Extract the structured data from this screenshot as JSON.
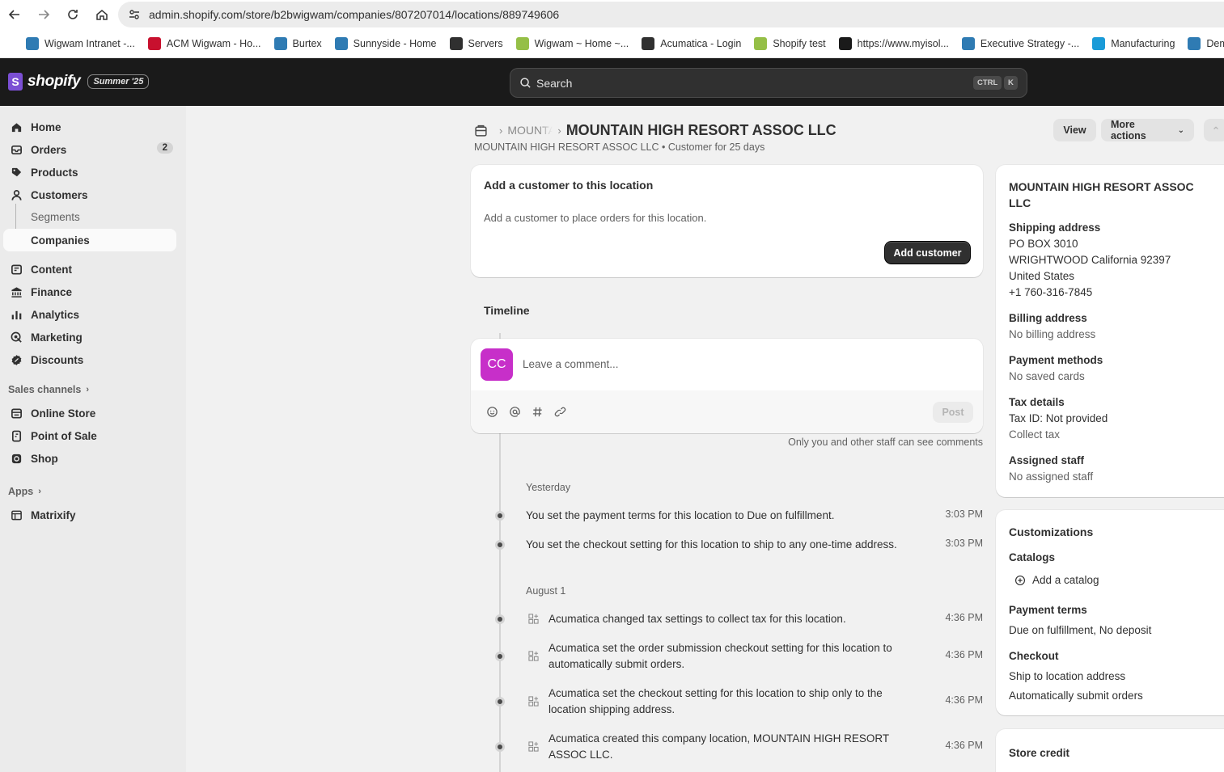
{
  "browser": {
    "url": "admin.shopify.com/store/b2bwigwam/companies/807207014/locations/889749606",
    "bookmarks": [
      {
        "label": "Wigwam Intranet -...",
        "color": "#2f7bb3"
      },
      {
        "label": "ACM Wigwam - Ho...",
        "color": "#c8102e"
      },
      {
        "label": "Burtex",
        "color": "#2f7bb3"
      },
      {
        "label": "Sunnyside - Home",
        "color": "#2f7bb3"
      },
      {
        "label": "Servers",
        "color": "#303030"
      },
      {
        "label": "Wigwam ~ Home ~...",
        "color": "#95bf47"
      },
      {
        "label": "Acumatica - Login",
        "color": "#303030"
      },
      {
        "label": "Shopify test",
        "color": "#95bf47"
      },
      {
        "label": "https://www.myisol...",
        "color": "#1a1a1a"
      },
      {
        "label": "Executive Strategy -...",
        "color": "#2f7bb3"
      },
      {
        "label": "Manufacturing",
        "color": "#1a9bd8"
      },
      {
        "label": "Deman",
        "color": "#2f7bb3"
      }
    ]
  },
  "topbar": {
    "logo_text": "shopify",
    "edition_badge": "Summer '25",
    "search_label": "Search",
    "kbd_ctrl": "CTRL",
    "kbd_k": "K"
  },
  "sidebar": {
    "items": [
      {
        "label": "Home",
        "icon": "home-icon"
      },
      {
        "label": "Orders",
        "icon": "orders-icon",
        "badge": "2"
      },
      {
        "label": "Products",
        "icon": "tag-icon"
      },
      {
        "label": "Customers",
        "icon": "person-icon"
      },
      {
        "label": "Content",
        "icon": "content-icon"
      },
      {
        "label": "Finance",
        "icon": "bank-icon"
      },
      {
        "label": "Analytics",
        "icon": "bar-chart-icon"
      },
      {
        "label": "Marketing",
        "icon": "target-icon"
      },
      {
        "label": "Discounts",
        "icon": "discount-icon"
      }
    ],
    "sub_items": [
      "Segments",
      "Companies"
    ],
    "sales_channels_label": "Sales channels",
    "channels": [
      {
        "label": "Online Store",
        "icon": "store-icon"
      },
      {
        "label": "Point of Sale",
        "icon": "pos-icon"
      },
      {
        "label": "Shop",
        "icon": "shop-icon"
      }
    ],
    "apps_label": "Apps",
    "apps": [
      {
        "label": "Matrixify",
        "icon": "app-icon"
      }
    ]
  },
  "header": {
    "breadcrumb_middle": "MOUNTAIN HIGH RESORT ASSOC LLC",
    "title": "MOUNTAIN HIGH RESORT ASSOC LLC",
    "subtitle": "MOUNTAIN HIGH RESORT ASSOC LLC • Customer for 25 days",
    "view_label": "View",
    "more_actions_label": "More actions"
  },
  "customer_card": {
    "title": "Add a customer to this location",
    "text": "Add a customer to place orders for this location.",
    "button": "Add customer"
  },
  "timeline": {
    "title": "Timeline",
    "avatar_initials": "CC",
    "comment_placeholder": "Leave a comment...",
    "post_label": "Post",
    "note": "Only you and other staff can see comments",
    "groups": [
      {
        "date": "Yesterday",
        "events": [
          {
            "text": "You set the payment terms for this location to Due on fulfillment.",
            "time": "3:03 PM"
          },
          {
            "text": "You set the checkout setting for this location to ship to any one-time address.",
            "time": "3:03 PM"
          }
        ]
      },
      {
        "date": "August 1",
        "events": [
          {
            "text": "Acumatica changed tax settings to collect tax for this location.",
            "time": "4:36 PM"
          },
          {
            "text": "Acumatica set the order submission checkout setting for this location to automatically submit orders.",
            "time": "4:36 PM"
          },
          {
            "text": "Acumatica set the checkout setting for this location to ship only to the location shipping address.",
            "time": "4:36 PM"
          },
          {
            "text": "Acumatica created this company location, MOUNTAIN HIGH RESORT ASSOC LLC.",
            "time": "4:36 PM"
          }
        ]
      }
    ]
  },
  "details_card": {
    "name": "MOUNTAIN HIGH RESORT ASSOC LLC",
    "shipping_title": "Shipping address",
    "shipping_lines": [
      "PO BOX 3010",
      "WRIGHTWOOD California 92397",
      "United States",
      "+1 760-316-7845"
    ],
    "billing_title": "Billing address",
    "billing_text": "No billing address",
    "payment_title": "Payment methods",
    "payment_text": "No saved cards",
    "tax_title": "Tax details",
    "tax_lines": [
      "Tax ID: Not provided",
      "Collect tax"
    ],
    "staff_title": "Assigned staff",
    "staff_text": "No assigned staff"
  },
  "customizations_card": {
    "title": "Customizations",
    "catalogs_title": "Catalogs",
    "add_catalog": "Add a catalog",
    "payment_terms_title": "Payment terms",
    "payment_terms_text": "Due on fulfillment, No deposit",
    "checkout_title": "Checkout",
    "checkout_lines": [
      "Ship to location address",
      "Automatically submit orders"
    ]
  },
  "store_credit_card": {
    "title": "Store credit"
  }
}
